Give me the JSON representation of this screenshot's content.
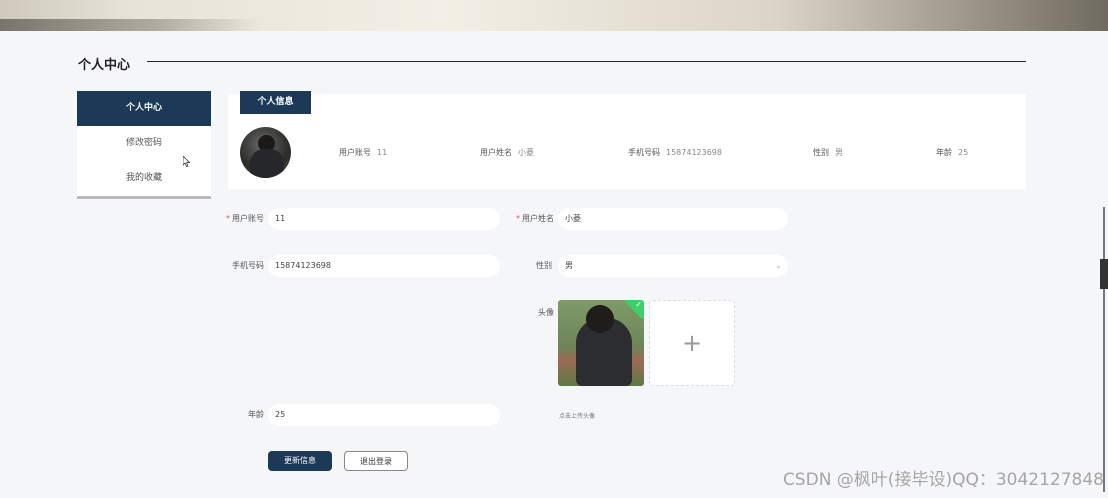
{
  "page": {
    "title": "个人中心"
  },
  "sidebar": {
    "items": [
      {
        "label": "个人中心",
        "active": true
      },
      {
        "label": "修改密码",
        "active": false
      },
      {
        "label": "我的收藏",
        "active": false
      }
    ]
  },
  "info_card": {
    "tab_label": "个人信息",
    "fields": [
      {
        "label": "用户账号",
        "value": "11"
      },
      {
        "label": "用户姓名",
        "value": "小菱"
      },
      {
        "label": "手机号码",
        "value": "15874123698"
      },
      {
        "label": "性别",
        "value": "男"
      },
      {
        "label": "年龄",
        "value": "25"
      }
    ]
  },
  "form": {
    "account": {
      "label": "用户账号",
      "value": "11",
      "required": true
    },
    "name": {
      "label": "用户姓名",
      "value": "小菱",
      "required": true
    },
    "phone": {
      "label": "手机号码",
      "value": "15874123698"
    },
    "gender": {
      "label": "性别",
      "value": "男"
    },
    "avatar": {
      "label": "头像",
      "hint": "点击上传头像",
      "add_symbol": "+"
    },
    "age": {
      "label": "年龄",
      "value": "25"
    },
    "required_mark": "*"
  },
  "buttons": {
    "update": "更新信息",
    "logout": "退出登录"
  },
  "watermark": "CSDN @枫叶(接毕设)QQ：3042127848",
  "colors": {
    "primary": "#1c3a57",
    "success": "#3ecf6a",
    "required": "#e54444"
  }
}
